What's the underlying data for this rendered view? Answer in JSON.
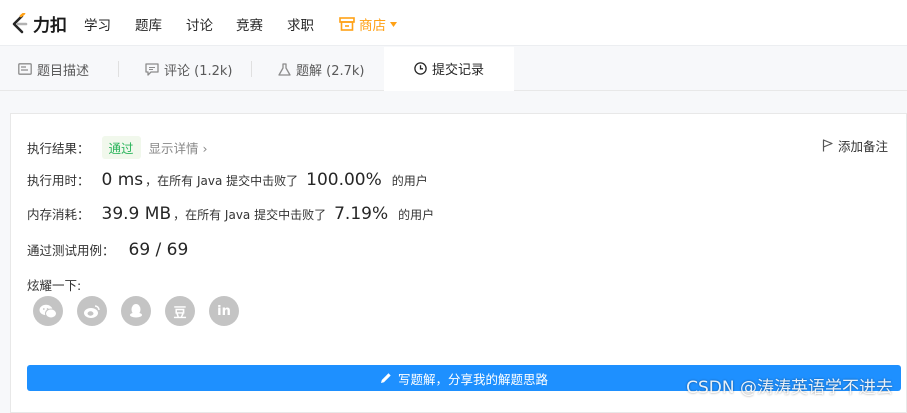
{
  "nav": {
    "logo_text": "力扣",
    "items": [
      "学习",
      "题库",
      "讨论",
      "竞赛",
      "求职"
    ],
    "store_label": "商店",
    "store_color": "#ffa116"
  },
  "tabs": [
    {
      "label": "题目描述",
      "icon": "description-icon"
    },
    {
      "label": "评论 (1.2k)",
      "icon": "comment-icon"
    },
    {
      "label": "题解 (2.7k)",
      "icon": "flask-icon"
    },
    {
      "label": "提交记录",
      "icon": "clock-icon",
      "active": true
    }
  ],
  "result": {
    "label": "执行结果：",
    "status": "通过",
    "status_color": "#2db55d",
    "detail_link": "显示详情 ›",
    "add_note": "添加备注"
  },
  "runtime": {
    "label": "执行用时：",
    "value": "0 ms",
    "mid_text": "，在所有 Java 提交中击败了",
    "percent": "100.00%",
    "suffix": "的用户"
  },
  "memory": {
    "label": "内存消耗：",
    "value": "39.9 MB",
    "mid_text": "，在所有 Java 提交中击败了",
    "percent": "7.19%",
    "suffix": "的用户"
  },
  "testcases": {
    "label": "通过测试用例：",
    "value": "69 / 69"
  },
  "share": {
    "label": "炫耀一下:",
    "buttons": [
      "wechat-icon",
      "weibo-icon",
      "qq-icon",
      "douban-icon",
      "linkedin-icon"
    ],
    "douban_char": "豆",
    "linkedin_text": "in"
  },
  "solution_button": "写题解，分享我的解题思路",
  "watermark": "CSDN @涛涛英语学不进去"
}
